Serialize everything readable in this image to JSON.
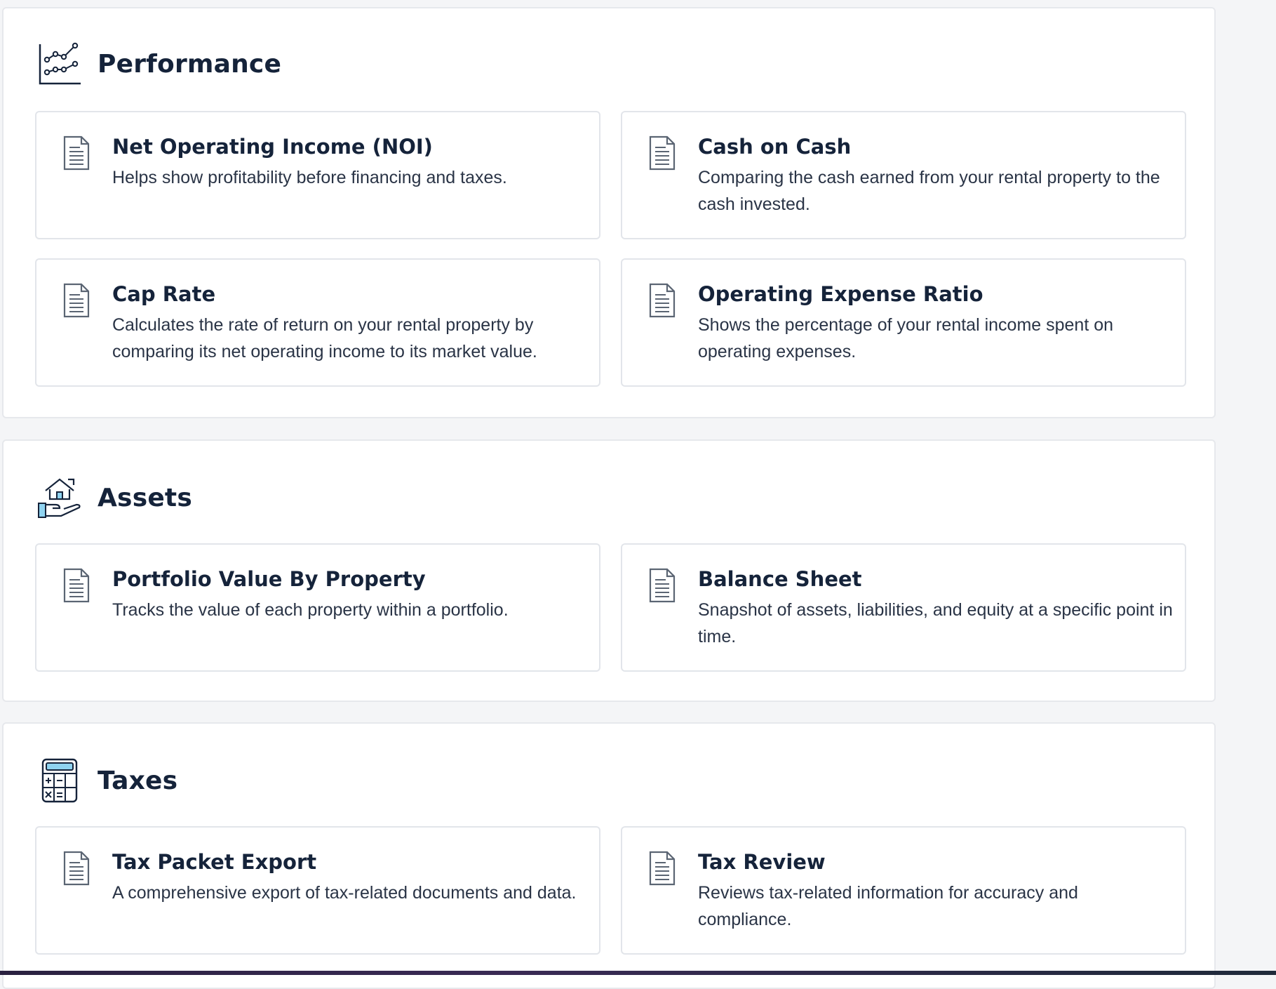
{
  "sections": [
    {
      "title": "Performance",
      "icon": "line-chart-icon",
      "cards": [
        {
          "title": "Net Operating Income (NOI)",
          "description": "Helps show profitability before financing and taxes.",
          "icon": "document-icon"
        },
        {
          "title": "Cash on Cash",
          "description": "Comparing the cash earned from your rental property to the cash invested.",
          "icon": "document-icon"
        },
        {
          "title": "Cap Rate",
          "description": "Calculates the rate of return on your rental property by comparing its net operating income to its market value.",
          "icon": "document-icon"
        },
        {
          "title": "Operating Expense Ratio",
          "description": "Shows the percentage of your rental income spent on operating expenses.",
          "icon": "document-icon"
        }
      ]
    },
    {
      "title": "Assets",
      "icon": "house-in-hand-icon",
      "cards": [
        {
          "title": "Portfolio Value By Property",
          "description": "Tracks the value of each property within a portfolio.",
          "icon": "document-icon"
        },
        {
          "title": "Balance Sheet",
          "description": "Snapshot of assets, liabilities, and equity at a specific point in time.",
          "icon": "document-icon"
        }
      ]
    },
    {
      "title": "Taxes",
      "icon": "calculator-icon",
      "cards": [
        {
          "title": "Tax Packet Export",
          "description": "A comprehensive export of tax-related documents and data.",
          "icon": "document-icon"
        },
        {
          "title": "Tax Review",
          "description": "Reviews tax-related information for accuracy and compliance.",
          "icon": "document-icon"
        }
      ]
    }
  ],
  "colors": {
    "page_background": "#f4f5f7",
    "card_border": "#e2e5ea",
    "heading_text": "#15233a",
    "body_text": "#2a3446",
    "icon_accent": "#8fd3f0"
  }
}
